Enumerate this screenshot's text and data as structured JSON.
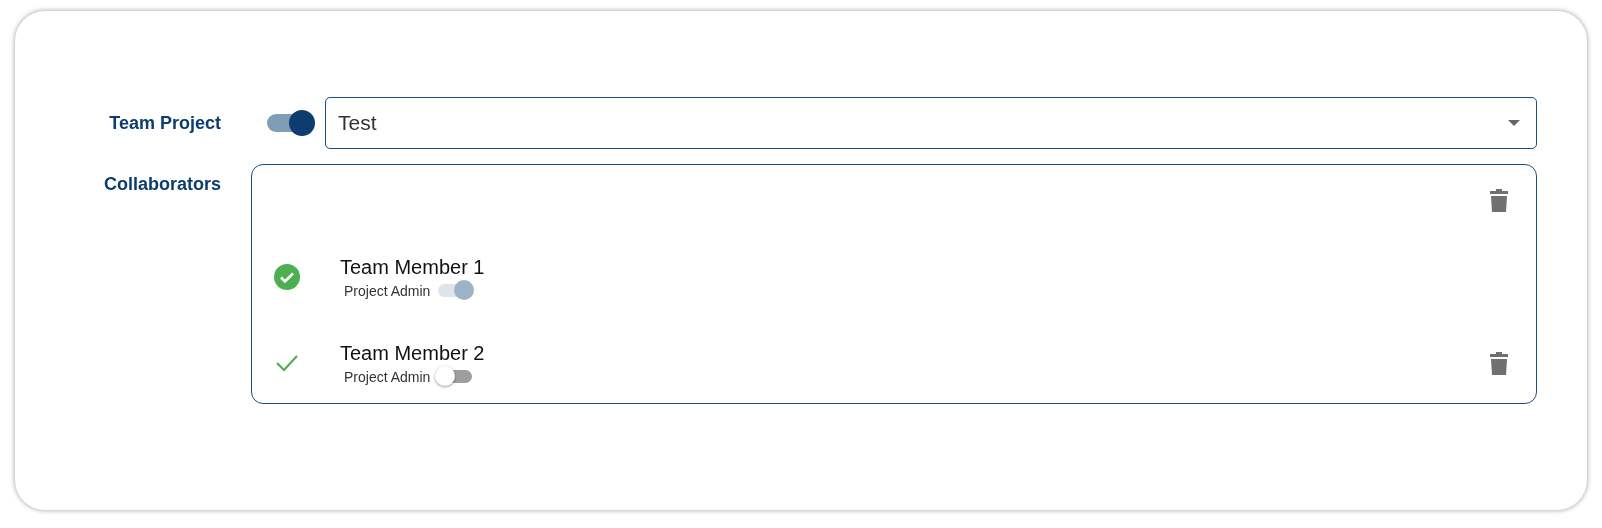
{
  "team_project": {
    "label": "Team Project",
    "on": true,
    "value": "Test"
  },
  "collaborators": {
    "label": "Collaborators",
    "members": [
      {
        "name": "Team Member 1",
        "verified": true,
        "admin_label": "Project Admin",
        "admin": true
      },
      {
        "name": "Team Member 2",
        "verified": false,
        "admin_label": "Project Admin",
        "admin": false
      }
    ]
  }
}
